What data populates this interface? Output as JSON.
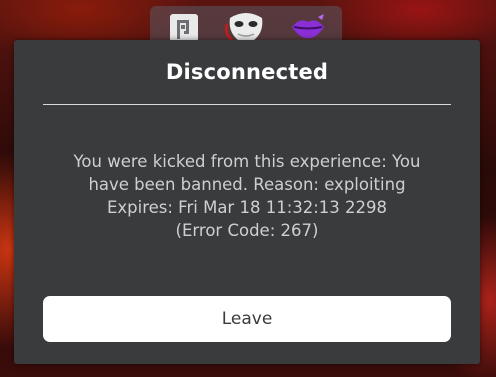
{
  "dialog": {
    "title": "Disconnected",
    "message_lines": [
      "You were kicked from this experience:  You",
      "have been banned. Reason: exploiting",
      "Expires: Fri Mar 18 11:32:13 2298",
      "(Error Code: 267)"
    ],
    "leave_label": "Leave"
  },
  "hotbar": {
    "items": [
      "tool-icon",
      "mask-icon",
      "lips-icon"
    ]
  },
  "colors": {
    "dialog_bg": "#393b3d",
    "title": "#ffffff",
    "message": "#cfcfcf",
    "button_bg": "#ffffff",
    "button_text": "#393b3d"
  }
}
